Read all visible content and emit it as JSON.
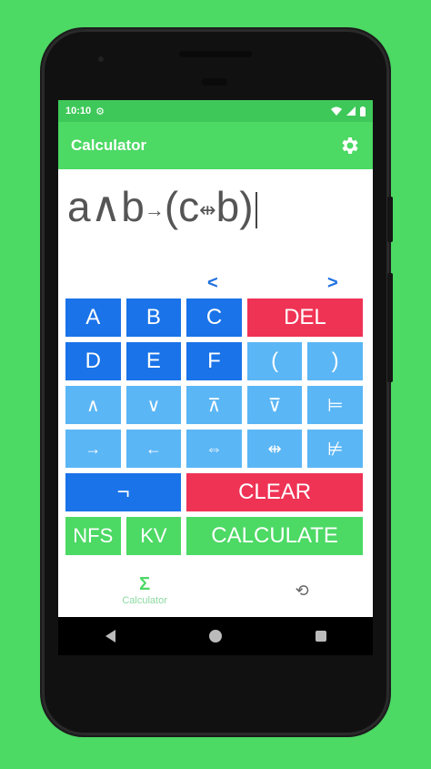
{
  "status": {
    "time": "10:10",
    "settings_glyph": "⚙"
  },
  "appbar": {
    "title": "Calculator",
    "settings_icon": "gear-icon"
  },
  "display": {
    "expression_parts": [
      "a∧b",
      "→",
      "(c",
      "⇹",
      "b)"
    ]
  },
  "nav": {
    "left": "<",
    "right": ">"
  },
  "keys": {
    "row1": [
      "A",
      "B",
      "C",
      "DEL"
    ],
    "row2": [
      "D",
      "E",
      "F",
      "(",
      ")"
    ],
    "row3": [
      "∧",
      "∨",
      "⊼",
      "⊽",
      "⊨"
    ],
    "row4": [
      "→",
      "←",
      "⇔",
      "⇹",
      "⊭"
    ],
    "row5": [
      "¬",
      "CLEAR"
    ],
    "row6": [
      "NFS",
      "KV",
      "CALCULATE"
    ]
  },
  "tabs": {
    "calculator": {
      "icon": "Σ",
      "label": "Calculator"
    },
    "history": {
      "icon": "⟲"
    }
  },
  "colors": {
    "background": "#4cd964",
    "blue": "#1a73e8",
    "light_blue": "#5bb6f5",
    "red": "#ef3355",
    "green": "#4cd964"
  }
}
